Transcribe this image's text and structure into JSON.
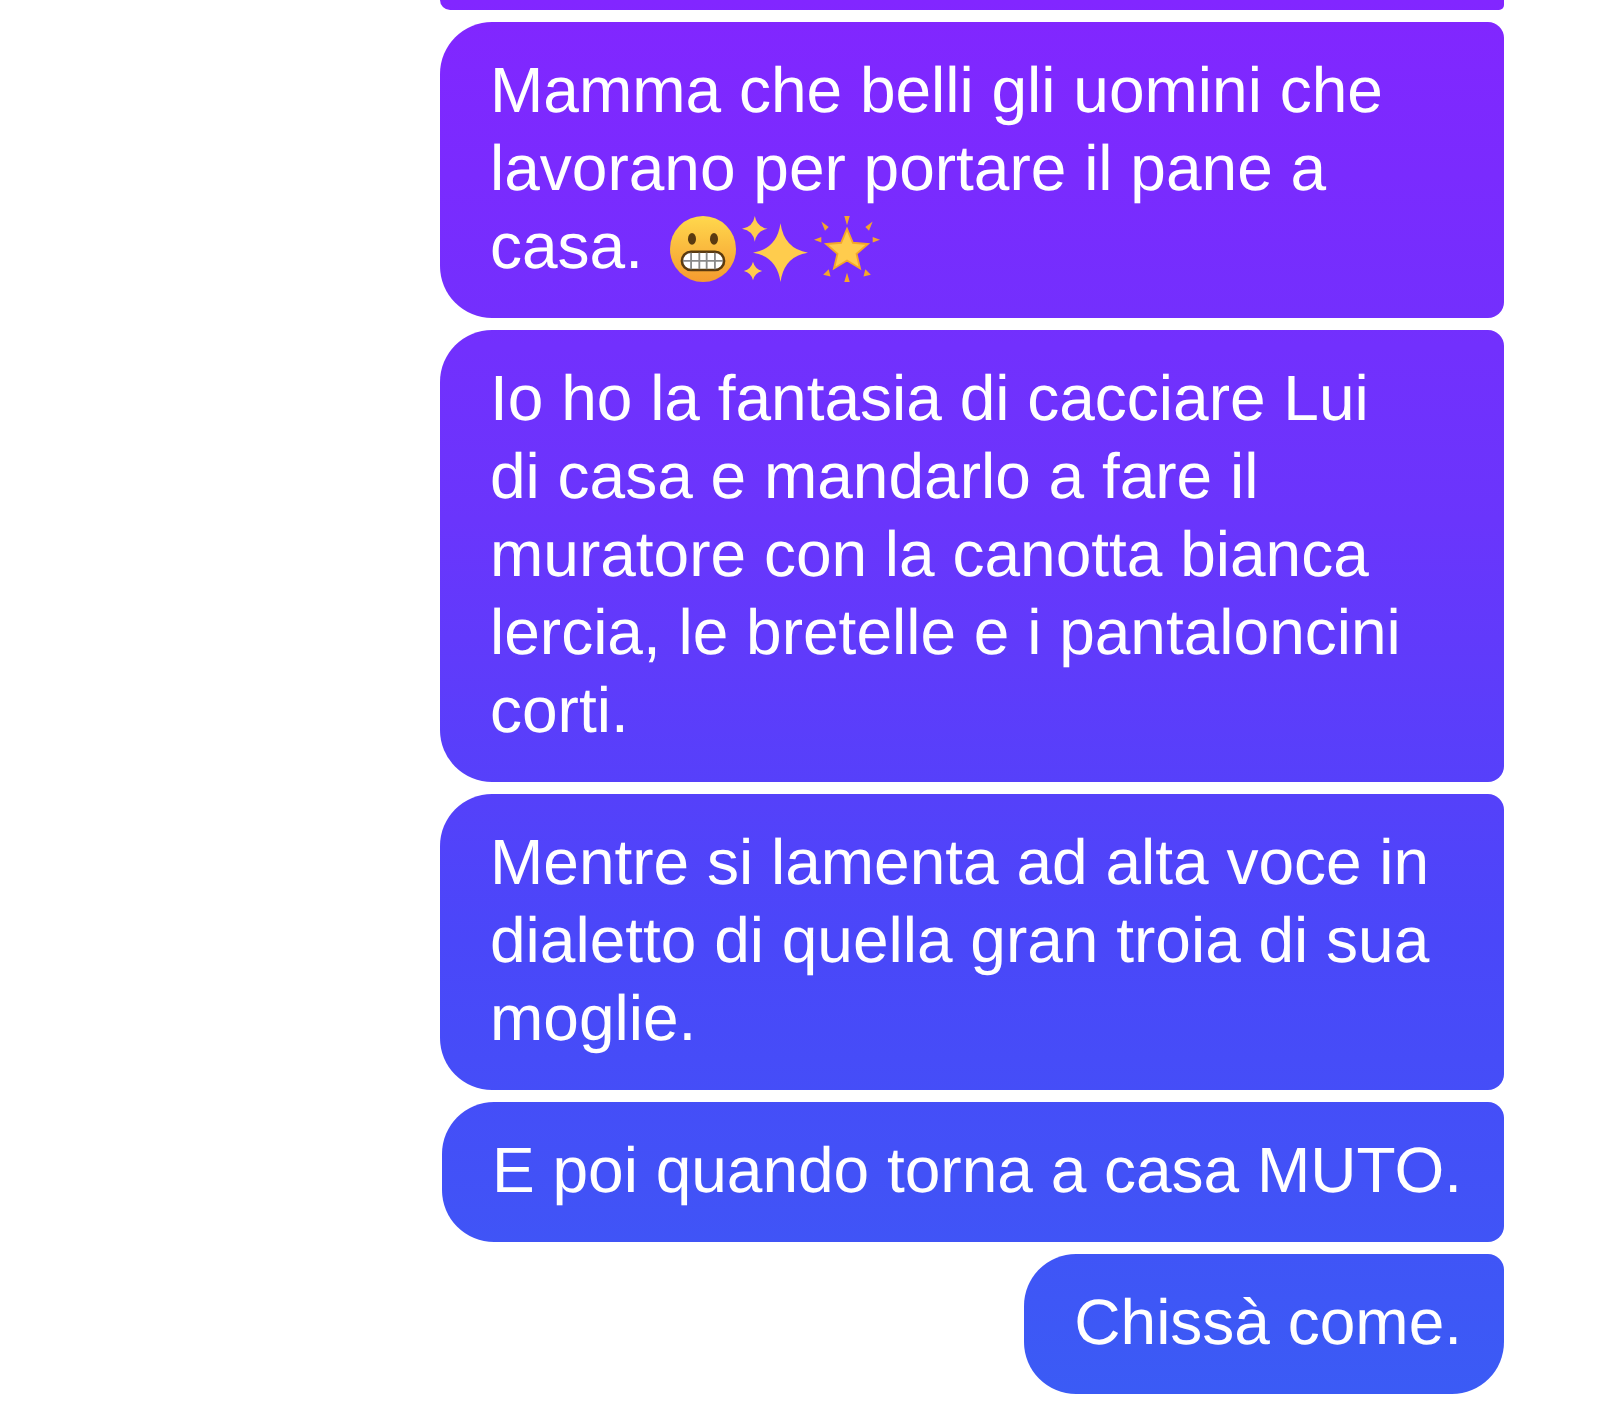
{
  "messages": [
    {
      "kind": "clipped"
    },
    {
      "kind": "text",
      "lines": [
        "Mamma che belli gli uomini che",
        "lavorano per portare il pane a",
        "casa."
      ],
      "emoji": [
        {
          "kind": "grimace"
        },
        {
          "kind": "sparkles"
        },
        {
          "kind": "glowing-star"
        }
      ]
    },
    {
      "kind": "text",
      "lines": [
        "Io ho la fantasia di cacciare Lui",
        "di casa e mandarlo a fare il",
        "muratore con la canotta bianca",
        "lercia, le bretelle e i pantaloncini",
        "corti."
      ]
    },
    {
      "kind": "text",
      "lines": [
        "Mentre si lamenta ad alta voce in",
        "dialetto di quella gran troia di sua",
        "moglie."
      ]
    },
    {
      "kind": "text",
      "lines": [
        "E poi quando torna a casa MUTO."
      ]
    },
    {
      "kind": "text",
      "lines": [
        "Chissà come."
      ]
    }
  ]
}
